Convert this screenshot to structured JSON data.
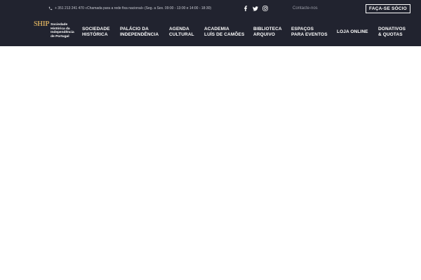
{
  "topbar": {
    "phone_text": "+ 351 213 241 470 «Chamada para a rede fixa nacional» (Seg. a Sex. 09:00 - 13:00 e 14:00 - 18:30)",
    "social_icons": [
      "facebook-icon",
      "twitter-icon",
      "instagram-icon"
    ],
    "contact_label": "Contacte-nos",
    "join_label": "FAÇA-SE SÓCIO"
  },
  "logo": {
    "mark": "SHIP",
    "lines": [
      "Sociedade",
      "Histórica da",
      "Independência",
      "de Portugal"
    ]
  },
  "nav": {
    "items": [
      {
        "line1": "SOCIEDADE",
        "line2": "HISTÓRICA"
      },
      {
        "line1": "PALÁCIO DA",
        "line2": "INDEPENDÊNCIA"
      },
      {
        "line1": "AGENDA",
        "line2": "CULTURAL"
      },
      {
        "line1": "ACADEMIA",
        "line2": "LUÍS DE CAMÕES"
      },
      {
        "line1": "BIBLIOTECA",
        "line2": "ARQUIVO"
      },
      {
        "line1": "ESPAÇOS",
        "line2": "PARA EVENTOS"
      },
      {
        "line1": "LOJA ONLINE",
        "line2": ""
      },
      {
        "line1": "DONATIVOS",
        "line2": "& QUOTAS"
      }
    ]
  },
  "colors": {
    "header_bg": "#21232f",
    "logo_gold": "#c7a15a",
    "text_white": "#ffffff",
    "muted_text": "#9a9ca6"
  }
}
